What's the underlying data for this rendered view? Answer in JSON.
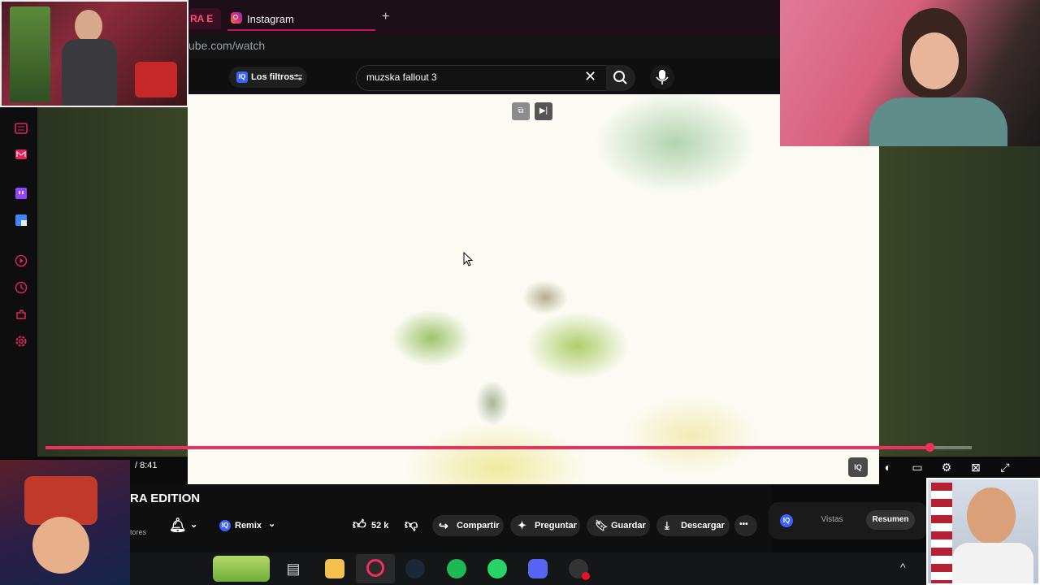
{
  "browser": {
    "active_tab_label": "RA E",
    "tab_instagram_label": "Instagram",
    "new_tab_symbol": "+",
    "address": "ube.com/watch"
  },
  "youtube_header": {
    "filters_label": "Los filtros",
    "filters_badge": "IQ",
    "search_value": "muzska fallout 3",
    "clear_symbol": "✕"
  },
  "player": {
    "time_display": "/ 8:41",
    "progress_fraction": 0.954,
    "buffered_fraction": 1.0,
    "iq_badge": "IQ"
  },
  "video_info": {
    "title": "RA EDITION",
    "subscribers_fragment": "tores",
    "remix_label": "Remix",
    "likes_label": "52 k",
    "share_label": "Compartir",
    "ask_label": "Preguntar",
    "save_label": "Guardar",
    "download_label": "Descargar",
    "more_symbol": "•••"
  },
  "side_panel": {
    "badge": "IQ",
    "tab_views": "Vistas",
    "tab_summary": "Resumen"
  },
  "taskbar": {
    "tray_up_symbol": "^"
  },
  "colors": {
    "accent": "#f22f5c",
    "iq_blue": "#3b62ff",
    "spotify": "#1db954",
    "whatsapp": "#25d366",
    "discord": "#5865f2"
  }
}
